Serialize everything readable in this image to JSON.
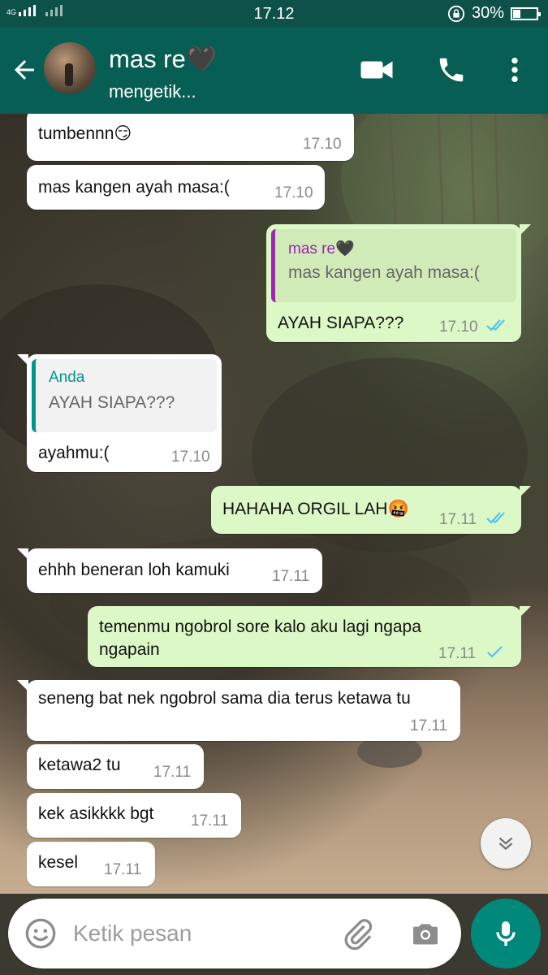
{
  "status_bar": {
    "time": "17.12",
    "battery": "30%",
    "network": "4G"
  },
  "header": {
    "contact_name": "mas re🖤",
    "status": "mengetik..."
  },
  "messages": [
    {
      "text": "tumbennn😏",
      "time": "17.10"
    },
    {
      "text": "mas kangen ayah masa:(",
      "time": "17.10"
    },
    {
      "quote_name": "mas re🖤",
      "quote_text": "mas kangen ayah masa:(",
      "text": "AYAH SIAPA???",
      "time": "17.10"
    },
    {
      "quote_name": "Anda",
      "quote_text": "AYAH SIAPA???",
      "text": "ayahmu:(",
      "time": "17.10"
    },
    {
      "text": "HAHAHA ORGIL LAH🤬",
      "time": "17.11"
    },
    {
      "text": "ehhh beneran loh kamuki",
      "time": "17.11"
    },
    {
      "text": "temenmu ngobrol sore kalo aku lagi ngapa ngapain",
      "time": "17.11"
    },
    {
      "text": "seneng bat nek ngobrol sama dia terus ketawa tu",
      "time": "17.11"
    },
    {
      "text": "ketawa2 tu",
      "time": "17.11"
    },
    {
      "text": "kek asikkkk bgt",
      "time": "17.11"
    },
    {
      "text": "kesel",
      "time": "17.11"
    }
  ],
  "input": {
    "placeholder": "Ketik pesan"
  },
  "icons": {
    "back": "arrow-left-icon",
    "video": "video-call-icon",
    "call": "phone-icon",
    "menu": "more-vert-icon",
    "emoji": "emoji-icon",
    "attach": "paperclip-icon",
    "camera": "camera-icon",
    "mic": "mic-icon",
    "scroll": "double-chevron-down-icon",
    "read": "double-check-icon",
    "sent": "single-check-icon"
  },
  "colors": {
    "header": "#075e54",
    "status_bar": "#0e5148",
    "outgoing_bubble": "#dcf8c6",
    "incoming_bubble": "#ffffff",
    "read_tick": "#4fc3f7",
    "quote_bar_incoming": "#9c27b0",
    "quote_bar_outgoing": "#009688",
    "mic_button": "#00897b"
  }
}
